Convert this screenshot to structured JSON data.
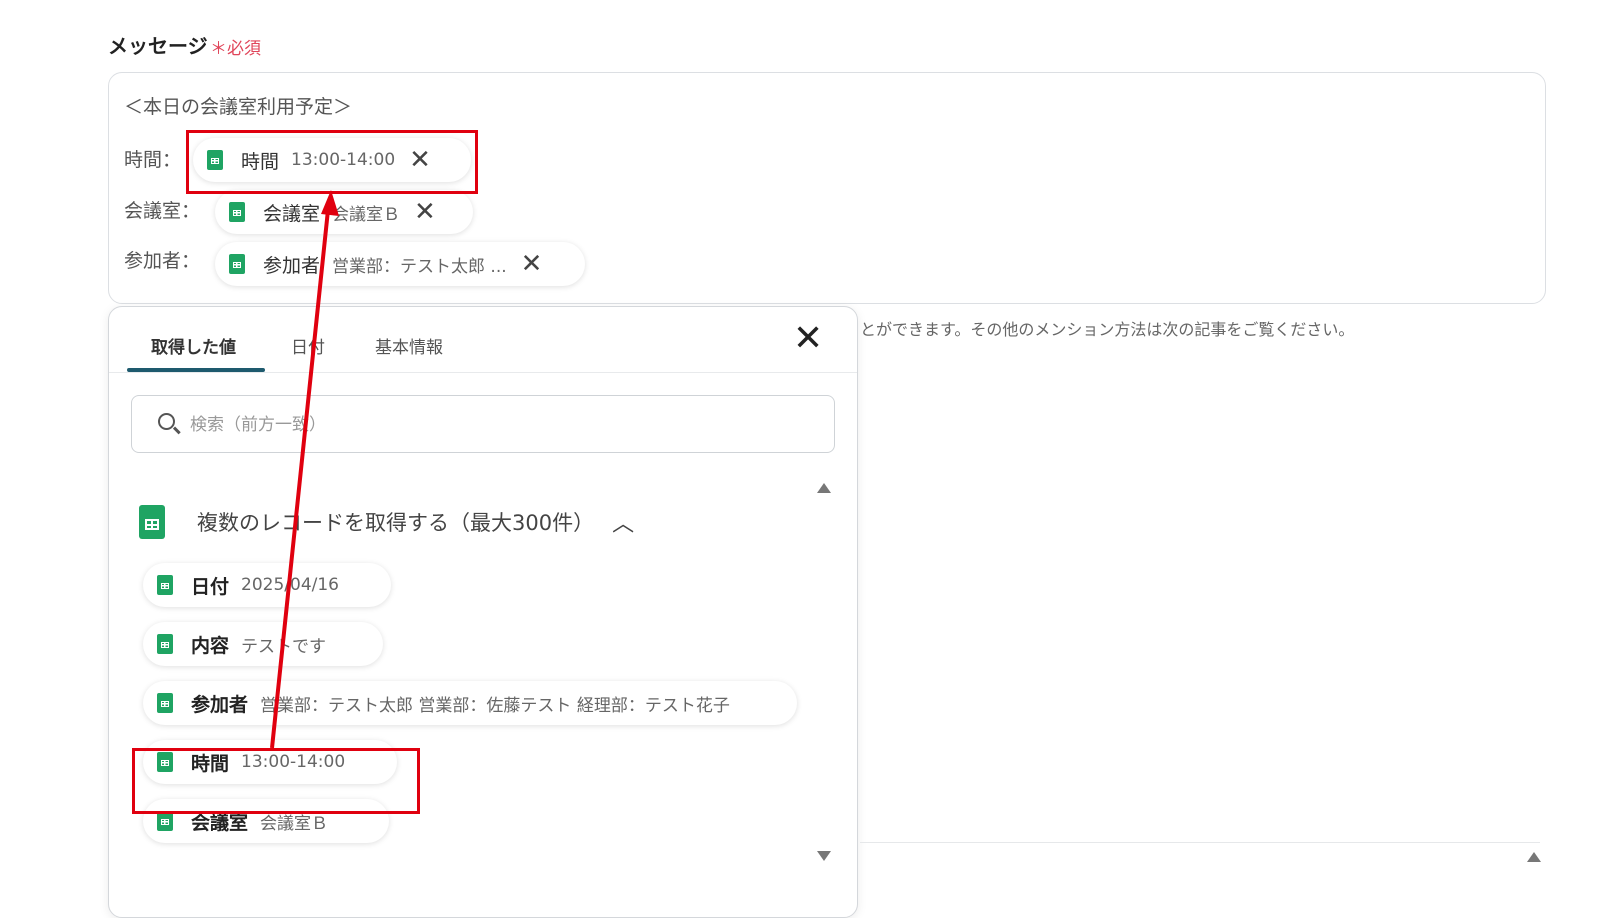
{
  "field": {
    "label": "メッセージ",
    "required_label": "＊必須"
  },
  "message": {
    "heading": "＜本日の会議室利用予定＞",
    "rows": [
      {
        "prefix": "時間：",
        "chip_name": "時間",
        "chip_value": "13:00-14:00"
      },
      {
        "prefix": "会議室：",
        "chip_name": "会議室",
        "chip_value": "会議室Ｂ"
      },
      {
        "prefix": "参加者：",
        "chip_name": "参加者",
        "chip_value": "営業部：テスト太郎 ..."
      }
    ],
    "remove_glyph": "✕"
  },
  "helper_text": "とができます。その他のメンション方法は次の記事をご覧ください。",
  "panel": {
    "tabs": [
      "取得した値",
      "日付",
      "基本情報"
    ],
    "close_glyph": "✕",
    "search_placeholder": "検索（前方一致）",
    "group_title": "複数のレコードを取得する（最大300件）",
    "group_chevron": "︿",
    "items": [
      {
        "name": "日付",
        "value": "2025/04/16"
      },
      {
        "name": "内容",
        "value": "テストです"
      },
      {
        "name": "参加者",
        "value": "営業部：テスト太郎 営業部：佐藤テスト 経理部：テスト花子"
      },
      {
        "name": "時間",
        "value": "13:00-14:00"
      },
      {
        "name": "会議室",
        "value": "会議室Ｂ"
      }
    ]
  },
  "icons": {
    "sheet": "spreadsheet-icon",
    "search": "search-icon",
    "close": "close-icon",
    "scroll_up": "scroll-up-icon",
    "scroll_down": "scroll-down-icon"
  },
  "colors": {
    "required": "#e0455a",
    "accent": "#1e5a6e",
    "sheet_green": "#1fa463",
    "annotation_red": "#e0000f"
  }
}
